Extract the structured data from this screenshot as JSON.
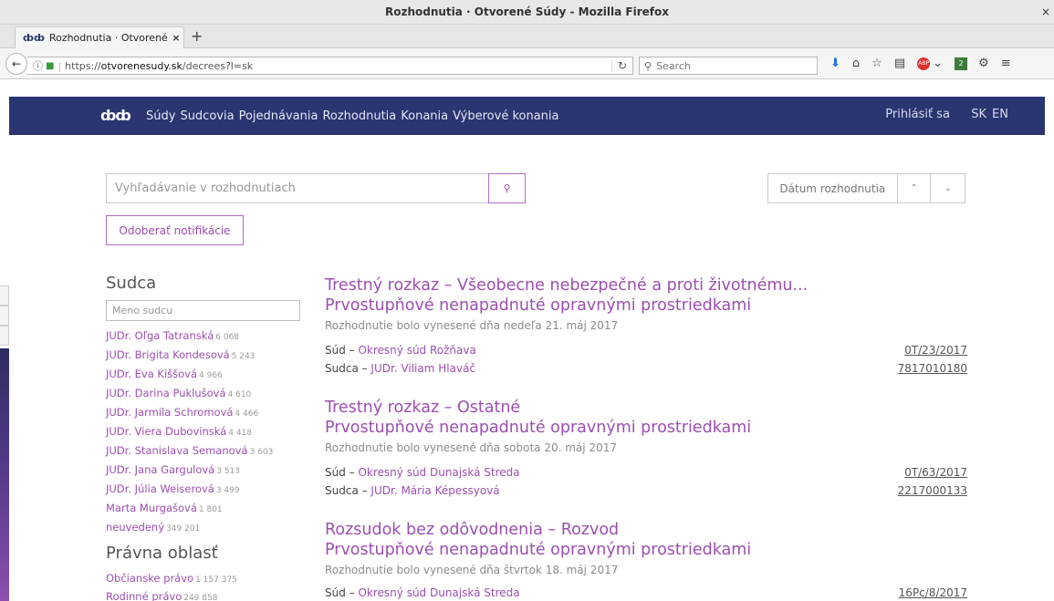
{
  "window": {
    "title": "Rozhodnutia · Otvorené Súdy - Mozilla Firefox",
    "close_glyph": "×"
  },
  "tab": {
    "icon": "ȸȸ",
    "title": "Rozhodnutia · Otvorené S",
    "close_glyph": "×",
    "new_tab_glyph": "+"
  },
  "toolbar": {
    "back_glyph": "←",
    "url_info": "ⓘ",
    "url_lock": "🔒",
    "url_prefix": "https://",
    "url_host": "otvorenesudy.sk",
    "url_path": "/decrees?l=sk",
    "reload_glyph": "↻",
    "search_glyph": "🔍",
    "search_placeholder": "Search",
    "icons": {
      "download": "⬇",
      "home": "⌂",
      "bookmark": "☆",
      "reader": "▤",
      "abp": "ABP",
      "chevron": "⌄",
      "ext": "2",
      "menu": "≡"
    }
  },
  "site": {
    "logo": "ȸȸ",
    "nav": [
      "Súdy",
      "Sudcovia",
      "Pojednávania",
      "Rozhodnutia",
      "Konania",
      "Výberové konania"
    ],
    "login": "Prihlásiť sa",
    "lang_sk": "SK",
    "lang_en": "EN"
  },
  "search": {
    "placeholder": "Vyhľadávanie v rozhodnutiach",
    "button_glyph": "⚲",
    "sort_label": "Dátum rozhodnutia",
    "sort_up_glyph": "⌃",
    "sort_down_glyph": "⌄",
    "notify_label": "Odoberať notifikácie"
  },
  "sidebar": {
    "judge_heading": "Sudca",
    "judge_placeholder": "Meno sudcu",
    "judges": [
      {
        "name": "JUDr. Oľga Tatranská",
        "count": "6 068"
      },
      {
        "name": "JUDr. Brigita Kondesová",
        "count": "5 243"
      },
      {
        "name": "JUDr. Eva Kiššová",
        "count": "4 966"
      },
      {
        "name": "JUDr. Darina Puklušová",
        "count": "4 610"
      },
      {
        "name": "JUDr. Jarmila Schromová",
        "count": "4 466"
      },
      {
        "name": "JUDr. Viera Dubovinská",
        "count": "4 418"
      },
      {
        "name": "JUDr. Stanislava Semanová",
        "count": "3 603"
      },
      {
        "name": "JUDr. Jana Gargulová",
        "count": "3 513"
      },
      {
        "name": "JUDr. Júlia Weiserová",
        "count": "3 499"
      },
      {
        "name": "Marta Murgašová",
        "count": "1 801"
      },
      {
        "name": "neuvedený",
        "count": "349 201"
      }
    ],
    "area_heading": "Právna oblasť",
    "areas": [
      {
        "name": "Občianske právo",
        "count": "1 157 375"
      },
      {
        "name": "Rodinné právo",
        "count": "249 858"
      }
    ]
  },
  "results": [
    {
      "title1": "Trestný rozkaz – Všeobecne nebezpečné a proti životnému...",
      "title2": "Prvostupňové nenapadnuté opravnými prostriedkami",
      "date": "Rozhodnutie bolo vynesené dňa nedeľa 21. máj 2017",
      "court_prefix": "Súd – ",
      "court": "Okresný súd Rožňava",
      "judge_prefix": "Sudca – ",
      "judge": "JUDr. Viliam Hlaváč",
      "file_no": "0T/23/2017",
      "ecli": "7817010180"
    },
    {
      "title1": "Trestný rozkaz – Ostatné",
      "title2": "Prvostupňové nenapadnuté opravnými prostriedkami",
      "date": "Rozhodnutie bolo vynesené dňa sobota 20. máj 2017",
      "court_prefix": "Súd – ",
      "court": "Okresný súd Dunajská Streda",
      "judge_prefix": "Sudca – ",
      "judge": "JUDr. Mária Képessyová",
      "file_no": "0T/63/2017",
      "ecli": "2217000133"
    },
    {
      "title1": "Rozsudok bez odôvodnenia – Rozvod",
      "title2": "Prvostupňové nenapadnuté opravnými prostriedkami",
      "date": "Rozhodnutie bolo vynesené dňa štvrtok 18. máj 2017",
      "court_prefix": "Súd – ",
      "court": "Okresný súd Dunajská Streda",
      "file_no": "16Pc/8/2017"
    }
  ]
}
